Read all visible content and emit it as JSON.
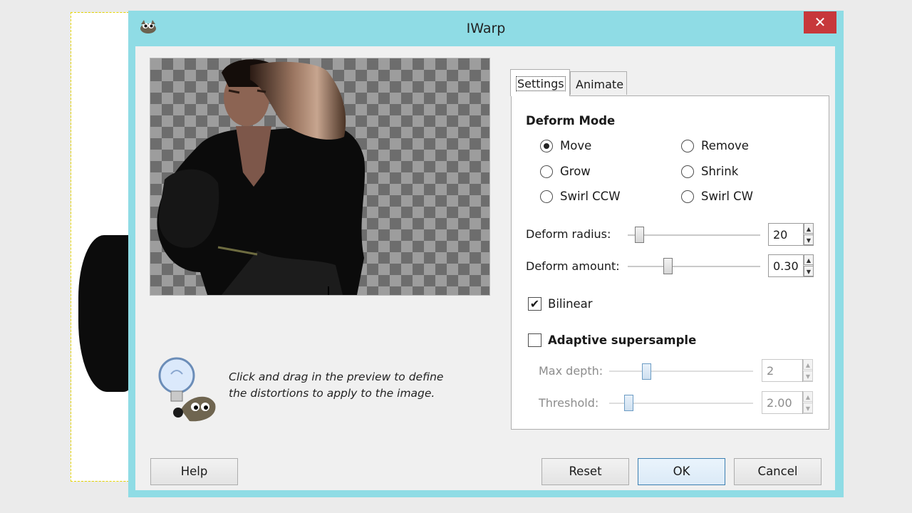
{
  "window": {
    "title": "IWarp",
    "close_glyph": "✕",
    "icon": "gimp-wilber-icon",
    "accent_color": "#8fdce5",
    "close_color": "#c7383b"
  },
  "tabs": [
    {
      "label": "Settings",
      "selected": true
    },
    {
      "label": "Animate",
      "selected": false
    }
  ],
  "hint": {
    "line1": "Click and drag in the preview to define",
    "line2": "the distortions to apply to the image."
  },
  "deform_mode": {
    "title": "Deform Mode",
    "options": [
      {
        "label": "Move",
        "checked": true
      },
      {
        "label": "Remove",
        "checked": false
      },
      {
        "label": "Grow",
        "checked": false
      },
      {
        "label": "Shrink",
        "checked": false
      },
      {
        "label": "Swirl CCW",
        "checked": false
      },
      {
        "label": "Swirl CW",
        "checked": false
      }
    ]
  },
  "deform_radius": {
    "label": "Deform radius:",
    "value": "20"
  },
  "deform_amount": {
    "label": "Deform amount:",
    "value": "0.30"
  },
  "bilinear": {
    "label": "Bilinear",
    "checked": true
  },
  "adaptive_supersample": {
    "label": "Adaptive supersample",
    "checked": false
  },
  "max_depth": {
    "label": "Max depth:",
    "value": "2"
  },
  "threshold": {
    "label": "Threshold:",
    "value": "2.00"
  },
  "buttons": {
    "help": "Help",
    "reset": "Reset",
    "ok": "OK",
    "cancel": "Cancel"
  }
}
